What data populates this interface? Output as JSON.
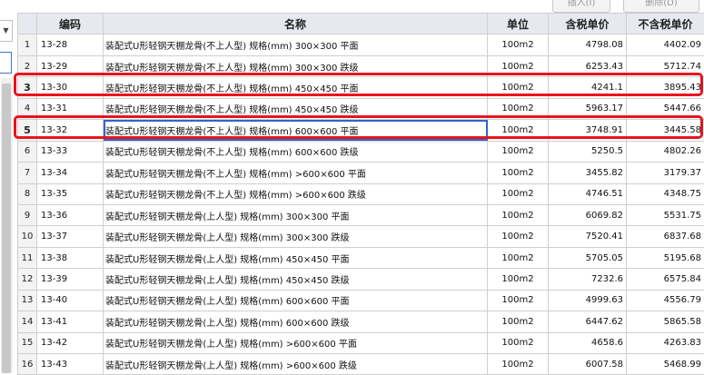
{
  "toolbar": {
    "insert_label": "插入(I)",
    "delete_label": "删除(D)"
  },
  "columns": {
    "code": "编码",
    "name": "名称",
    "unit": "单位",
    "price_tax": "含税单价",
    "price_notax": "不含税单价"
  },
  "rows": [
    {
      "idx": "1",
      "code": "13-28",
      "name": "装配式U形轻钢天棚龙骨(不上人型) 规格(mm) 300×300 平面",
      "unit": "100m2",
      "tax": "4798.08",
      "notax": "4402.09"
    },
    {
      "idx": "2",
      "code": "13-29",
      "name": "装配式U形轻钢天棚龙骨(不上人型) 规格(mm) 300×300 跌级",
      "unit": "100m2",
      "tax": "6253.43",
      "notax": "5712.74"
    },
    {
      "idx": "3",
      "code": "13-30",
      "name": "装配式U形轻钢天棚龙骨(不上人型) 规格(mm) 450×450 平面",
      "unit": "100m2",
      "tax": "4241.1",
      "notax": "3895.43"
    },
    {
      "idx": "4",
      "code": "13-31",
      "name": "装配式U形轻钢天棚龙骨(不上人型) 规格(mm) 450×450 跌级",
      "unit": "100m2",
      "tax": "5963.17",
      "notax": "5447.66"
    },
    {
      "idx": "5",
      "code": "13-32",
      "name": "装配式U形轻钢天棚龙骨(不上人型) 规格(mm) 600×600 平面",
      "unit": "100m2",
      "tax": "3748.91",
      "notax": "3445.58"
    },
    {
      "idx": "6",
      "code": "13-33",
      "name": "装配式U形轻钢天棚龙骨(不上人型) 规格(mm) 600×600 跌级",
      "unit": "100m2",
      "tax": "5250.5",
      "notax": "4802.26"
    },
    {
      "idx": "7",
      "code": "13-34",
      "name": "装配式U形轻钢天棚龙骨(不上人型) 规格(mm) >600×600 平面",
      "unit": "100m2",
      "tax": "3455.82",
      "notax": "3179.37"
    },
    {
      "idx": "8",
      "code": "13-35",
      "name": "装配式U形轻钢天棚龙骨(不上人型) 规格(mm) >600×600 跌级",
      "unit": "100m2",
      "tax": "4746.51",
      "notax": "4348.75"
    },
    {
      "idx": "9",
      "code": "13-36",
      "name": "装配式U形轻钢天棚龙骨(上人型) 规格(mm) 300×300 平面",
      "unit": "100m2",
      "tax": "6069.82",
      "notax": "5531.75"
    },
    {
      "idx": "10",
      "code": "13-37",
      "name": "装配式U形轻钢天棚龙骨(上人型) 规格(mm) 300×300 跌级",
      "unit": "100m2",
      "tax": "7520.41",
      "notax": "6837.68"
    },
    {
      "idx": "11",
      "code": "13-38",
      "name": "装配式U形轻钢天棚龙骨(上人型) 规格(mm) 450×450 平面",
      "unit": "100m2",
      "tax": "5705.05",
      "notax": "5195.68"
    },
    {
      "idx": "12",
      "code": "13-39",
      "name": "装配式U形轻钢天棚龙骨(上人型) 规格(mm) 450×450 跌级",
      "unit": "100m2",
      "tax": "7232.6",
      "notax": "6575.84"
    },
    {
      "idx": "13",
      "code": "13-40",
      "name": "装配式U形轻钢天棚龙骨(上人型) 规格(mm) 600×600 平面",
      "unit": "100m2",
      "tax": "4999.63",
      "notax": "4556.79"
    },
    {
      "idx": "14",
      "code": "13-41",
      "name": "装配式U形轻钢天棚龙骨(上人型) 规格(mm) 600×600 跌级",
      "unit": "100m2",
      "tax": "6447.62",
      "notax": "5865.58"
    },
    {
      "idx": "15",
      "code": "13-42",
      "name": "装配式U形轻钢天棚龙骨(上人型) 规格(mm) >600×600 平面",
      "unit": "100m2",
      "tax": "4658.6",
      "notax": "4263.83"
    },
    {
      "idx": "16",
      "code": "13-43",
      "name": "装配式U形轻钢天棚龙骨(上人型) 规格(mm) >600×600 跌级",
      "unit": "100m2",
      "tax": "6007.58",
      "notax": "5468.99"
    }
  ],
  "highlighted_rows": [
    "3",
    "5"
  ],
  "selected_cell": {
    "row": "5",
    "column": "name"
  },
  "colors": {
    "highlight_box": "#e8141e",
    "selection": "#2f66c8",
    "header_bg": "#e6eaf0"
  }
}
